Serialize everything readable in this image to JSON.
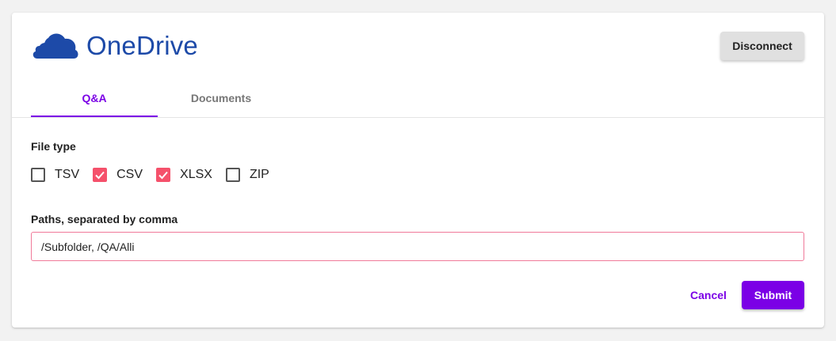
{
  "header": {
    "brand_name": "OneDrive",
    "logo_icon": "onedrive-cloud-icon",
    "disconnect_label": "Disconnect"
  },
  "tabs": [
    {
      "label": "Q&A",
      "active": true
    },
    {
      "label": "Documents",
      "active": false
    }
  ],
  "form": {
    "file_type_label": "File type",
    "file_types": [
      {
        "label": "TSV",
        "checked": false
      },
      {
        "label": "CSV",
        "checked": true
      },
      {
        "label": "XLSX",
        "checked": true
      },
      {
        "label": "ZIP",
        "checked": false
      }
    ],
    "paths_label": "Paths, separated by comma",
    "paths_value": "/Subfolder, /QA/Alli"
  },
  "actions": {
    "cancel_label": "Cancel",
    "submit_label": "Submit"
  },
  "colors": {
    "brand": "#1d4aa8",
    "accent": "#7b00e6",
    "checkbox_checked": "#f5516b",
    "input_border": "#f07a9a"
  }
}
